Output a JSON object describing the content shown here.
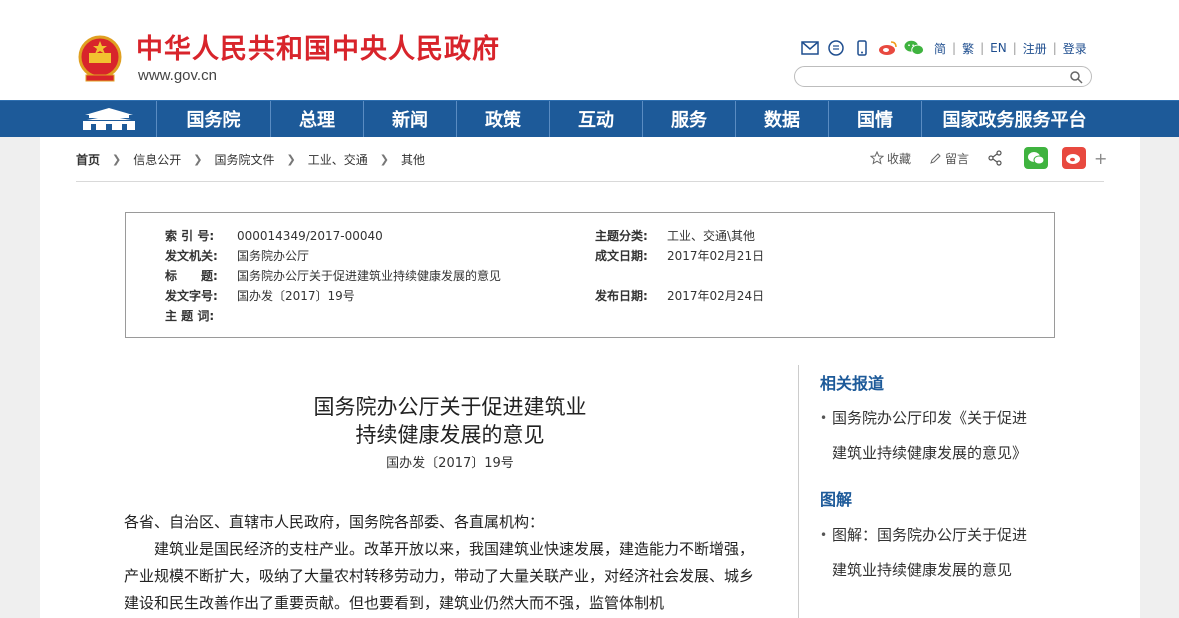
{
  "header": {
    "site_title": "中华人民共和国中央人民政府",
    "site_url": "www.gov.cn",
    "lang_links": [
      "简",
      "繁",
      "EN",
      "注册",
      "登录"
    ],
    "search": {
      "placeholder": ""
    }
  },
  "nav": {
    "items": [
      "国务院",
      "总理",
      "新闻",
      "政策",
      "互动",
      "服务",
      "数据",
      "国情",
      "国家政务服务平台"
    ]
  },
  "breadcrumb": [
    "首页",
    "信息公开",
    "国务院文件",
    "工业、交通",
    "其他"
  ],
  "share_bar": {
    "favorite": "收藏",
    "comment": "留言"
  },
  "info_table": {
    "left": [
      {
        "label": "索 引 号:",
        "value": "000014349/2017-00040"
      },
      {
        "label": "发文机关:",
        "value": "国务院办公厅"
      },
      {
        "label": "标　　题:",
        "value": "国务院办公厅关于促进建筑业持续健康发展的意见"
      },
      {
        "label": "发文字号:",
        "value": "国办发〔2017〕19号"
      },
      {
        "label": "主 题 词:",
        "value": ""
      }
    ],
    "right": [
      {
        "label": "主题分类:",
        "value": "工业、交通\\其他"
      },
      {
        "label": "成文日期:",
        "value": "2017年02月21日"
      },
      {
        "label": "发布日期:",
        "value": "2017年02月24日"
      }
    ]
  },
  "article": {
    "title_line1": "国务院办公厅关于促进建筑业",
    "title_line2": "持续健康发展的意见",
    "doc_number": "国办发〔2017〕19号",
    "salutation": "各省、自治区、直辖市人民政府，国务院各部委、各直属机构：",
    "paragraph1": "建筑业是国民经济的支柱产业。改革开放以来，我国建筑业快速发展，建造能力不断增强，产业规模不断扩大，吸纳了大量农村转移劳动力，带动了大量关联产业，对经济社会发展、城乡建设和民生改善作出了重要贡献。但也要看到，建筑业仍然大而不强，监管体制机"
  },
  "sidebar": {
    "sections": [
      {
        "heading": "相关报道",
        "items": [
          {
            "line1": "国务院办公厅印发《关于促进",
            "line2": "建筑业持续健康发展的意见》"
          }
        ]
      },
      {
        "heading": "图解",
        "items": [
          {
            "line1": "图解：国务院办公厅关于促进",
            "line2": "建筑业持续健康发展的意见"
          }
        ]
      }
    ]
  },
  "colors": {
    "brand_red": "#d8242b",
    "nav_blue": "#1d5a99",
    "wechat_green": "#3fb33f",
    "weibo_red": "#e8493f"
  }
}
